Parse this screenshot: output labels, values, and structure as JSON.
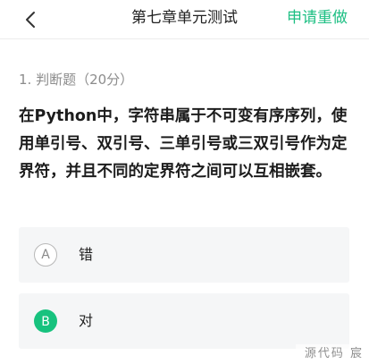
{
  "header": {
    "title": "第七章单元测试",
    "back_icon": "chevron-left-icon",
    "action_label": "申请重做"
  },
  "question": {
    "meta": "1. 判断题（20分）",
    "text": "在Python中，字符串属于不可变有序序列，使用单引号、双引号、三单引号或三双引号作为定界符，并且不同的定界符之间可以互相嵌套。"
  },
  "options": [
    {
      "letter": "A",
      "label": "错",
      "selected": false
    },
    {
      "letter": "B",
      "label": "对",
      "selected": true
    }
  ],
  "watermark": "源代码 宸",
  "colors": {
    "accent": "#1dbf83",
    "selected_badge": "#17c27e",
    "option_bg": "#f5f6f7"
  }
}
